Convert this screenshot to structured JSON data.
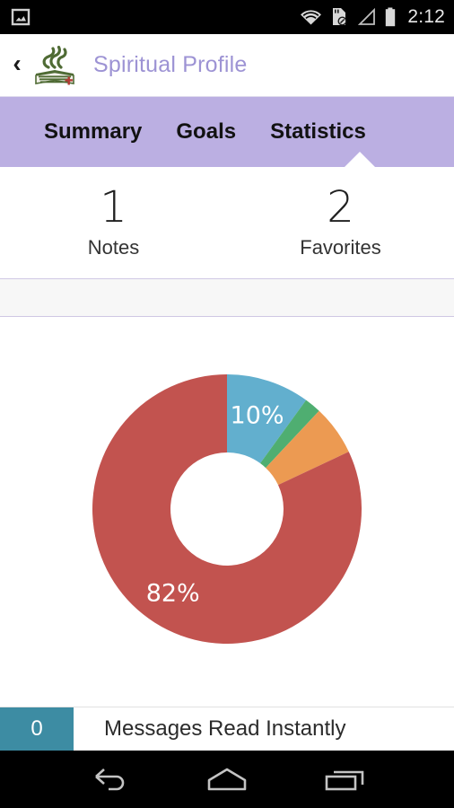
{
  "status_bar": {
    "left_icons": [
      {
        "name": "screenshot-image-icon"
      }
    ],
    "right_icons": [
      {
        "name": "wifi-icon"
      },
      {
        "name": "sd-card-disabled-icon"
      },
      {
        "name": "cell-signal-icon"
      },
      {
        "name": "battery-icon"
      }
    ],
    "clock": "2:12",
    "background": "#000000"
  },
  "action_bar": {
    "back_icon": "back-chevron-icon",
    "back_glyph": "‹",
    "logo_name": "church-of-the-nazarene-logo",
    "title": "Spiritual Profile",
    "title_color": "#9d93d4",
    "background": "#ffffff"
  },
  "tab_bar": {
    "background": "#bbafe2",
    "indicator_color": "#ffffff",
    "active_index": 2,
    "tabs": [
      {
        "label": "Summary"
      },
      {
        "label": "Goals"
      },
      {
        "label": "Statistics"
      }
    ]
  },
  "counters": [
    {
      "value": "1",
      "label": "Notes"
    },
    {
      "value": "2",
      "label": "Favorites"
    }
  ],
  "chart_data": {
    "type": "pie",
    "variant": "donut",
    "title": "",
    "legend": "none",
    "start_angle_deg": 0,
    "inner_radius_ratio": 0.42,
    "categories": [
      "Segment 1",
      "Segment 2",
      "Segment 3",
      "Segment 4"
    ],
    "values": [
      10,
      2,
      6,
      82
    ],
    "labels": [
      "10%",
      "",
      "",
      "82%"
    ],
    "visible_labels": [
      "10%",
      "82%"
    ],
    "colors": [
      "#62afce",
      "#4fae71",
      "#ec9a52",
      "#c2534f"
    ],
    "units": "percent",
    "total": 100
  },
  "list_rows": [
    {
      "badge_value": "0",
      "badge_color": "#3d8ca3",
      "label": "Messages Read Instantly"
    }
  ],
  "nav_bar": {
    "background": "#000000",
    "buttons": [
      {
        "name": "back-button"
      },
      {
        "name": "home-button"
      },
      {
        "name": "recents-button"
      }
    ]
  }
}
